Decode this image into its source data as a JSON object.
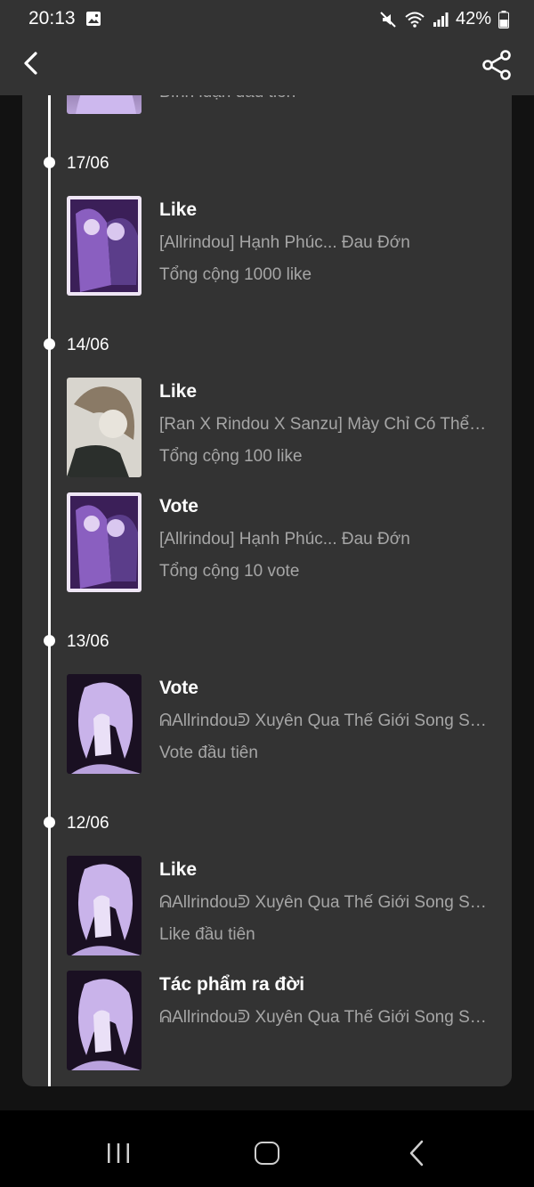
{
  "status_bar": {
    "time": "20:13",
    "battery": "42%"
  },
  "timeline": [
    {
      "date": "",
      "items": [
        {
          "title": "",
          "subtitle": "Bình luận đầu tiên",
          "detail": ""
        }
      ]
    },
    {
      "date": "17/06",
      "items": [
        {
          "title": "Like",
          "subtitle": "[Allrindou] Hạnh Phúc... Đau Đớn",
          "detail": "Tổng cộng 1000 like"
        }
      ]
    },
    {
      "date": "14/06",
      "items": [
        {
          "title": "Like",
          "subtitle": "[Ran X Rindou X Sanzu] Mày Chỉ Có Thể C...",
          "detail": "Tổng cộng 100 like"
        },
        {
          "title": "Vote",
          "subtitle": "[Allrindou] Hạnh Phúc... Đau Đớn",
          "detail": "Tổng cộng 10 vote"
        }
      ]
    },
    {
      "date": "13/06",
      "items": [
        {
          "title": "Vote",
          "subtitle": "ᕱAllrindouᕲ Xuyên Qua Thế Giới Song So...",
          "detail": "Vote đầu tiên"
        }
      ]
    },
    {
      "date": "12/06",
      "items": [
        {
          "title": "Like",
          "subtitle": "ᕱAllrindouᕲ Xuyên Qua Thế Giới Song So...",
          "detail": "Like đầu tiên"
        },
        {
          "title": "Tác phẩm ra đời",
          "subtitle": "ᕱAllrindouᕲ Xuyên Qua Thế Giới Song So...",
          "detail": ""
        }
      ]
    }
  ],
  "icons": {
    "back": "chevron-left-icon",
    "share": "share-icon"
  },
  "colors": {
    "surface": "#333333",
    "muted_text": "#a6a6a6"
  }
}
